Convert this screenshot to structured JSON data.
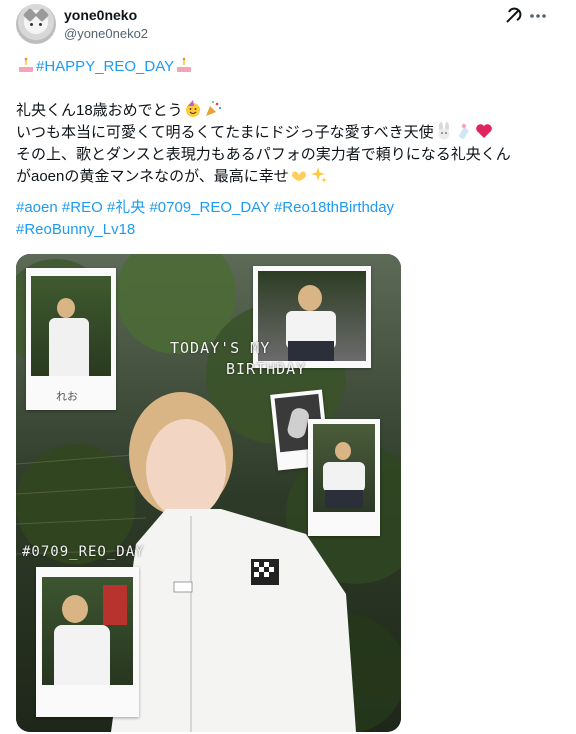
{
  "author": {
    "display_name": "yone0neko",
    "handle": "@yone0neko2"
  },
  "post": {
    "line1_tag": "#HAPPY_REO_DAY",
    "line2": "礼央くん18歳おめでとう",
    "line3": "いつも本当に可愛くて明るくてたまにドジっ子な愛すべき天使",
    "line4": "その上、歌とダンスと表現力もあるパフォの実力者で頼りになる礼央くん",
    "line5": "がaoenの黄金マンネなのが、最高に幸せ",
    "hashtags_row1": [
      "#aoen",
      "#REO",
      "#礼央",
      "#0709_REO_DAY",
      "#Reo18thBirthday"
    ],
    "hashtags_row2": [
      "#ReoBunny_Lv18"
    ]
  },
  "media": {
    "overlay_birthday_1": "TODAY'S MY",
    "overlay_birthday_2": "BIRTHDAY",
    "overlay_date_tag": "#0709_REO_DAY",
    "polaroid_caption": "れお"
  },
  "icons": {
    "grok": "grok-icon",
    "more": "more-icon",
    "cake": "cake-emoji",
    "party_face": "party-face-emoji",
    "popper": "party-popper-emoji",
    "rabbit": "rabbit-emoji",
    "bottle": "baby-bottle-emoji",
    "heart": "heart-emoji",
    "hands_heart": "heart-hands-emoji",
    "sparkles": "sparkles-emoji"
  },
  "colors": {
    "link": "#1d9bf0",
    "secondary_text": "#536471",
    "primary_text": "#0f1419"
  }
}
